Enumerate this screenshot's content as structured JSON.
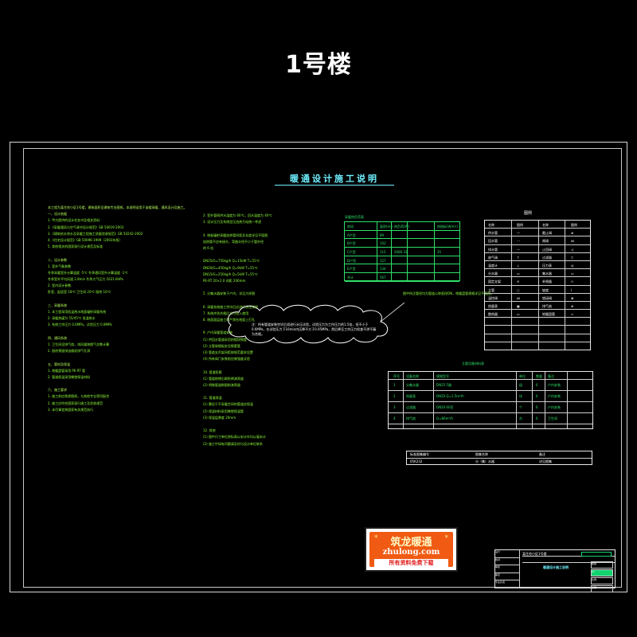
{
  "page_title": "1号楼",
  "drawing_title": "暖通设计施工说明",
  "notes_left": [
    {
      "text": "本工程为某住宅小区1号楼，建筑面积见建筑专业图纸，本说明适用于该楼采暖、通风设计及施工。",
      "heading": true
    },
    {
      "text": "一、设计依据",
      "heading": true
    },
    {
      "text": "1. 甲方提供的设计任务书及相关资料",
      "heading": false
    },
    {
      "text": "2.《采暖通风与空气调节设计规范》GB 50019-2003",
      "heading": false
    },
    {
      "text": "3.《建筑给水排水及采暖工程施工质量验收规范》GB 50242-2002",
      "heading": false
    },
    {
      "text": "4.《住宅设计规范》GB 50096-1999（2003年版）",
      "heading": false
    },
    {
      "text": "5. 其他相关的国家现行设计规范及标准",
      "heading": false
    },
    {
      "text": "",
      "heading": false
    },
    {
      "text": "二、设计参数",
      "heading": true
    },
    {
      "text": "1. 室外气象参数",
      "heading": false
    },
    {
      "text": "冬季采暖室外计算温度 -5℃  冬季通风室外计算温度 -1℃",
      "heading": false
    },
    {
      "text": "冬季室外平均风速 2.8m/s  冬季大气压力 1021.6hPa",
      "heading": false
    },
    {
      "text": "2. 室内设计参数",
      "heading": false
    },
    {
      "text": "卧室、起居室 18℃  卫生间 20℃  厨房 16℃",
      "heading": false
    },
    {
      "text": "",
      "heading": false
    },
    {
      "text": "三、采暖系统",
      "heading": true
    },
    {
      "text": "1. 本工程采用低温热水地面辐射采暖系统",
      "heading": false
    },
    {
      "text": "2. 采暖热媒为 55/45℃ 低温热水",
      "heading": false
    },
    {
      "text": "3. 系统工作压力 0.6MPa，试验压力 0.8MPa",
      "heading": false
    },
    {
      "text": "",
      "heading": false
    },
    {
      "text": "四、通风系统",
      "heading": true
    },
    {
      "text": "1. 卫生间设排气扇，排风量按换气次数计算",
      "heading": false
    },
    {
      "text": "2. 厨房预留排油烟机排气孔洞",
      "heading": false
    },
    {
      "text": "",
      "heading": false
    },
    {
      "text": "五、管材及保温",
      "heading": true
    },
    {
      "text": "1. 地暖盘管采用 PE-RT 管",
      "heading": false
    },
    {
      "text": "2. 管道保温采用橡塑保温材料",
      "heading": false
    },
    {
      "text": "",
      "heading": false
    },
    {
      "text": "六、施工要求",
      "heading": true
    },
    {
      "text": "1. 施工前应熟悉图纸，与其他专业密切配合",
      "heading": false
    },
    {
      "text": "2. 施工应符合国家现行施工及验收规范",
      "heading": false
    },
    {
      "text": "3. 未尽事宜按国家有关规范执行",
      "heading": false
    }
  ],
  "notes_mid": [
    "2. 室外管网供水温度为 60℃，回水温度为 40℃",
    "3. 设计压力及系统定压由热力站统一考虑",
    "",
    "4. 地板辐射采暖加热管间距及长度详见平面图",
    "   加热管不应有接头，弯曲半径不小于管外径",
    "   的 6 倍",
    "",
    "DN25/G=750kg/h  Q=15kW  T=55℃",
    "DN20/G=450kg/h  Q=9kW   T=55℃",
    "DN15/G=250kg/h  Q=5kW   T=55℃",
    "PE-RT 20×2.0  间距 200mm",
    "",
    "5. 分集水器安装于户内，详见大样图",
    "",
    "6. 采暖系统施工完毕后应进行水压试验",
    "7. 系统冲洗合格后方可投入使用",
    "8. 地面面层施工时严禁在地面上打孔",
    "",
    "9. 户内采暖管道安装",
    "(1) 供回水管道采用热镀锌钢管",
    "(2) 立管穿楼板处设钢套管",
    "(3) 管道支吊架间距按规范要求设置",
    "(4) 所有阀门安装前应做强度试验",
    "",
    "10. 管道防腐",
    "(1) 管道除锈后刷防锈漆两道",
    "(2) 明装管道刷银粉漆两道",
    "",
    "11. 管道保温",
    "(1) 敷设于不采暖空间的管道应保温",
    "(2) 保温材料采用橡塑保温管",
    "(3) 保温层厚度 20mm",
    "",
    "12. 其他",
    "(1) 图中尺寸单位除标高以米计外均以毫米计",
    "(2) 施工中如有问题请及时与设计单位联系"
  ],
  "heat_table": {
    "title": "采暖热负荷表",
    "headers": [
      "房间",
      "面积(m²)",
      "热负荷(W)",
      "热指标(W/m²)"
    ],
    "rows": [
      [
        "A户型",
        "89",
        "",
        ""
      ],
      [
        "B户型",
        "102",
        "",
        ""
      ],
      [
        "C户型",
        "115",
        "2680.33",
        "35"
      ],
      [
        "D户型",
        "127",
        "",
        ""
      ],
      [
        "E户型",
        "134",
        "",
        ""
      ],
      [
        "合计",
        "567",
        "",
        ""
      ]
    ]
  },
  "callout_text": "图中所注管径均为管道公称直径DN，地暖盘管规格详见平面图。",
  "cloud_text": "注：所有管道安装完毕后须进行水压试验，试验压力为工作压力的1.5倍，但不小于0.6MPa，在试验压力下10min内压降不大于0.05MPa，然后降至工作压力检查不渗不漏为合格。",
  "legend": {
    "title": "图例",
    "rows": [
      [
        "名称",
        "图例",
        "名称",
        "图例"
      ],
      [
        "供水管",
        "—",
        "截止阀",
        "⊗"
      ],
      [
        "回水管",
        "- -",
        "闸阀",
        "⋈"
      ],
      [
        "排水管",
        "—",
        "止回阀",
        "◁"
      ],
      [
        "放气阀",
        "↑",
        "过滤器",
        "▽"
      ],
      [
        "温度计",
        "⊥",
        "压力表",
        "◎"
      ],
      [
        "分水器",
        "▭",
        "集水器",
        "▭"
      ],
      [
        "固定支架",
        "✕",
        "补偿器",
        "∩"
      ],
      [
        "立管",
        "○",
        "坡度",
        "i"
      ],
      [
        "温控阀",
        "⋈",
        "锁闭阀",
        "⊠"
      ],
      [
        "热量表",
        "▣",
        "排气扇",
        "⊕"
      ],
      [
        "散热器",
        "▭",
        "地暖盘管",
        "≈"
      ],
      [
        "",
        "",
        "",
        ""
      ],
      [
        "",
        "",
        "",
        ""
      ],
      [
        "",
        "",
        "",
        ""
      ]
    ]
  },
  "equip_table": {
    "title": "主要设备材料表",
    "headers": [
      "序号",
      "设备名称",
      "规格型号",
      "单位",
      "数量",
      "备注"
    ],
    "rows": [
      [
        "1",
        "分集水器",
        "DN25 5路",
        "组",
        "6",
        "户内安装"
      ],
      [
        "2",
        "热量表",
        "DN20 Q=1.5m³/h",
        "块",
        "6",
        "户内安装"
      ],
      [
        "3",
        "过滤器",
        "DN20 60目",
        "个",
        "6",
        "户内安装"
      ],
      [
        "4",
        "排气扇",
        "Q=80m³/h",
        "台",
        "6",
        "卫生间"
      ]
    ]
  },
  "std_table": {
    "headers": [
      "标准图集编号",
      "图集名称",
      "备注"
    ],
    "row": [
      "05K232",
      "分（集）水器",
      "详见图集"
    ]
  },
  "title_block": {
    "left_rows": [
      "设计",
      "校对",
      "审核",
      "审定",
      "专业负责"
    ],
    "project": "某住宅小区1号楼",
    "drawing_name": "暖通设计施工说明",
    "cells": [
      "暖施",
      "01",
      "比例",
      "日期"
    ]
  },
  "watermark": {
    "stars": "*",
    "name": "筑龙暖通",
    "url": "zhulong.com",
    "subtitle": "所有资料免费下载"
  },
  "colors": {
    "background": "#000000",
    "border": "#d8d8d8",
    "text_green": "#8fff3a",
    "table_green": "#2fe06a",
    "title_cyan": "#6ff0ff",
    "watermark_orange": "#f05a12",
    "watermark_red": "#e01818"
  }
}
